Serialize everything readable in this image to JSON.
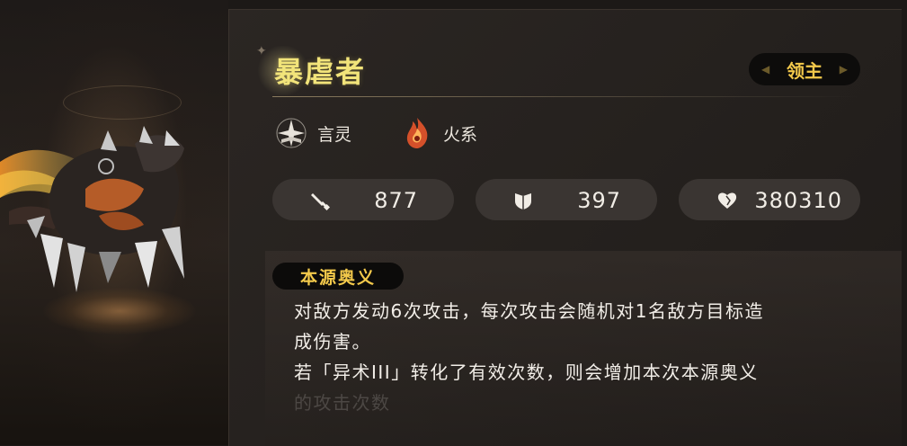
{
  "monster": {
    "name": "暴虐者",
    "rank": "领主"
  },
  "traits": [
    {
      "icon": "book-star-icon",
      "label": "言灵"
    },
    {
      "icon": "fire-element-icon",
      "label": "火系"
    }
  ],
  "stats": {
    "attack": "877",
    "defense": "397",
    "hp": "380310"
  },
  "skill": {
    "tag": "本源奥义",
    "lines": [
      "对敌方发动6次攻击，每次攻击会随机对1名敌方目标造",
      "成伤害。",
      "若「异术III」转化了有效次数，则会增加本次本源奥义",
      "的攻击次数"
    ]
  },
  "colors": {
    "title": "#f2e47a",
    "badge_text": "#f3c94b",
    "panel_bg": "#2b2623",
    "pill_bg": "#3a3532"
  }
}
